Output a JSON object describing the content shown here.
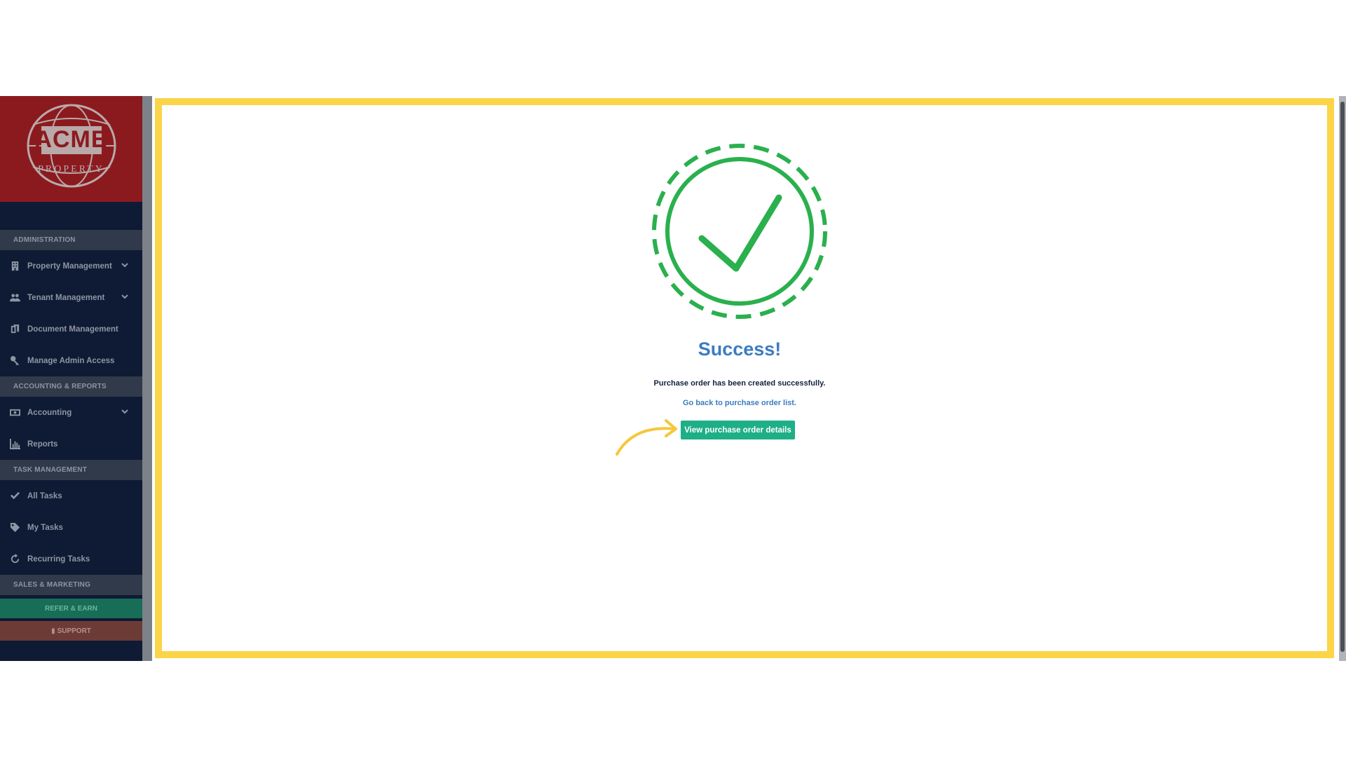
{
  "sidebar": {
    "logo": {
      "word": "ACME",
      "sub": "PROPERTY"
    },
    "sections": [
      {
        "title": "ADMINISTRATION",
        "items": [
          {
            "label": "Property Management",
            "icon": "building-icon",
            "has_chevron": true
          },
          {
            "label": "Tenant Management",
            "icon": "users-icon",
            "has_chevron": true
          },
          {
            "label": "Document Management",
            "icon": "documents-icon",
            "has_chevron": false
          },
          {
            "label": "Manage Admin Access",
            "icon": "key-icon",
            "has_chevron": false
          }
        ]
      },
      {
        "title": "ACCOUNTING & REPORTS",
        "items": [
          {
            "label": "Accounting",
            "icon": "money-icon",
            "has_chevron": true
          },
          {
            "label": "Reports",
            "icon": "bar-chart-icon",
            "has_chevron": false
          }
        ]
      },
      {
        "title": "TASK MANAGEMENT",
        "items": [
          {
            "label": "All Tasks",
            "icon": "check-icon",
            "has_chevron": false
          },
          {
            "label": "My Tasks",
            "icon": "tag-icon",
            "has_chevron": false
          },
          {
            "label": "Recurring Tasks",
            "icon": "refresh-icon",
            "has_chevron": false
          }
        ]
      },
      {
        "title": "SALES & MARKETING",
        "items": []
      }
    ],
    "refer_label": "REFER & EARN",
    "support_label": "SUPPORT"
  },
  "main": {
    "title": "Success!",
    "message": "Purchase order has been created successfully.",
    "back_link": "Go back to purchase order list.",
    "view_button": "View purchase order details"
  },
  "colors": {
    "sidebar_bg": "#0f1a34",
    "brand_bg": "#8b1a1f",
    "success_green": "#2ab04d",
    "title_blue": "#3b7cc0",
    "button_teal": "#1eaf86",
    "highlight_yellow": "#fbd448"
  }
}
